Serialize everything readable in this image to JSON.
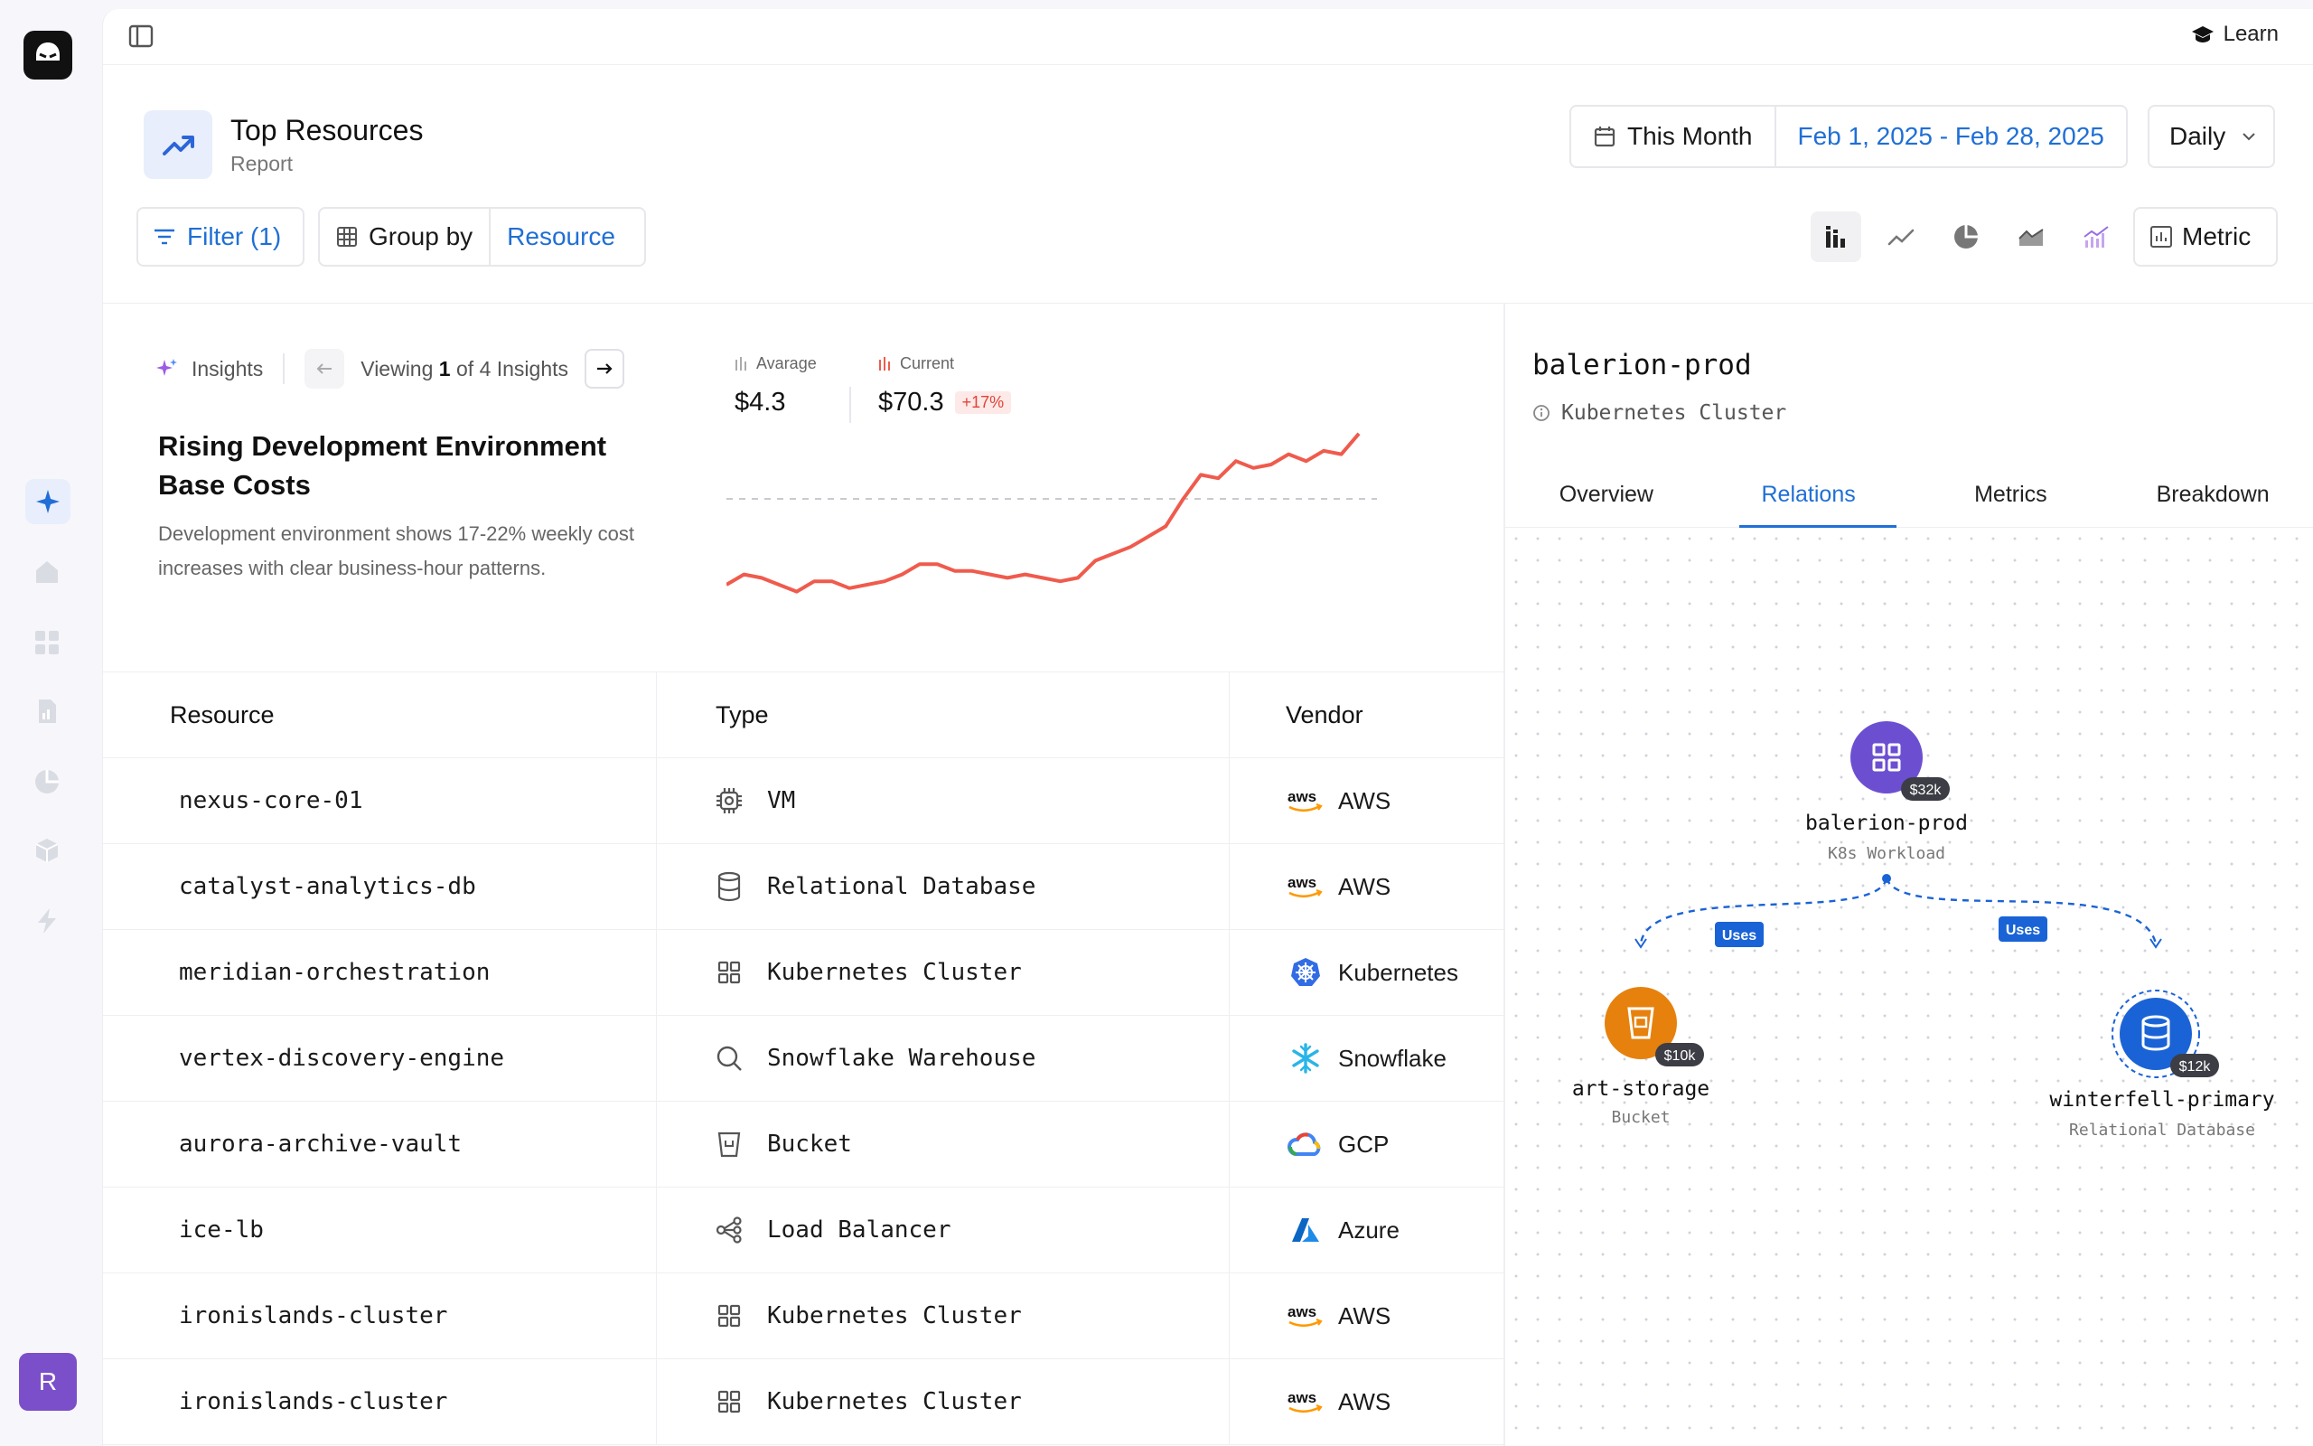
{
  "topbar": {
    "learn_label": "Learn"
  },
  "page": {
    "title": "Top Resources",
    "subtitle": "Report"
  },
  "date": {
    "preset": "This Month",
    "range": "Feb 1, 2025 - Feb 28, 2025",
    "granularity": "Daily"
  },
  "toolbar": {
    "filter_label": "Filter (1)",
    "groupby_label": "Group by",
    "groupby_value": "Resource",
    "metric_label": "Metric"
  },
  "user": {
    "initial": "R"
  },
  "insights": {
    "label": "Insights",
    "viewing_prefix": "Viewing",
    "current_index": "1",
    "of_label": "of",
    "total": "4",
    "suffix": "Insights",
    "title": "Rising Development Environment Base Costs",
    "description": "Development environment shows 17-22% weekly cost increases with clear business-hour patterns.",
    "average_label": "Avarage",
    "average_value": "$4.3",
    "current_label": "Current",
    "current_value": "$70.3",
    "current_delta": "+17%"
  },
  "sparkline": {
    "values": [
      5,
      8,
      7,
      5,
      3,
      6,
      6,
      4,
      5,
      6,
      8,
      11,
      11,
      9,
      9,
      8,
      7,
      8,
      7,
      6,
      7,
      12,
      14,
      16,
      19,
      22,
      30,
      37,
      36,
      41,
      39,
      40,
      43,
      41,
      44,
      43,
      49
    ],
    "average": 30,
    "color": "#ef5b4d"
  },
  "table": {
    "headers": [
      "Resource",
      "Type",
      "Vendor"
    ],
    "rows": [
      {
        "resource": "nexus-core-01",
        "type": "VM",
        "type_icon": "chip-icon",
        "vendor": "AWS",
        "vendor_icon": "aws-logo-icon"
      },
      {
        "resource": "catalyst-analytics-db",
        "type": "Relational Database",
        "type_icon": "database-icon",
        "vendor": "AWS",
        "vendor_icon": "aws-logo-icon"
      },
      {
        "resource": "meridian-orchestration",
        "type": "Kubernetes Cluster",
        "type_icon": "grid-icon",
        "vendor": "Kubernetes",
        "vendor_icon": "kubernetes-logo-icon"
      },
      {
        "resource": "vertex-discovery-engine",
        "type": "Snowflake Warehouse",
        "type_icon": "search-icon",
        "vendor": "Snowflake",
        "vendor_icon": "snowflake-logo-icon"
      },
      {
        "resource": "aurora-archive-vault",
        "type": "Bucket",
        "type_icon": "bucket-icon",
        "vendor": "GCP",
        "vendor_icon": "gcp-logo-icon"
      },
      {
        "resource": "ice-lb",
        "type": "Load Balancer",
        "type_icon": "load-balancer-icon",
        "vendor": "Azure",
        "vendor_icon": "azure-logo-icon"
      },
      {
        "resource": "ironislands-cluster",
        "type": "Kubernetes Cluster",
        "type_icon": "grid-icon",
        "vendor": "AWS",
        "vendor_icon": "aws-logo-icon"
      },
      {
        "resource": "ironislands-cluster",
        "type": "Kubernetes Cluster",
        "type_icon": "grid-icon",
        "vendor": "AWS",
        "vendor_icon": "aws-logo-icon"
      }
    ]
  },
  "panel": {
    "title": "balerion-prod",
    "subtitle": "Kubernetes Cluster",
    "tabs": [
      "Overview",
      "Relations",
      "Metrics",
      "Breakdown"
    ],
    "active_tab": "Relations"
  },
  "graph": {
    "center": {
      "name": "balerion-prod",
      "kind": "K8s Workload",
      "cost": "$32k",
      "color": "#6c4fd1"
    },
    "left": {
      "name": "art-storage",
      "kind": "Bucket",
      "cost": "$10k",
      "color": "#e6810e"
    },
    "right": {
      "name": "winterfell-primary",
      "kind": "Relational Database",
      "cost": "$12k",
      "color": "#1a63d6"
    },
    "edge_label": "Uses"
  },
  "colors": {
    "accent": "#1f6fd6",
    "danger": "#e0453a",
    "avatar": "#7b4fc9"
  }
}
